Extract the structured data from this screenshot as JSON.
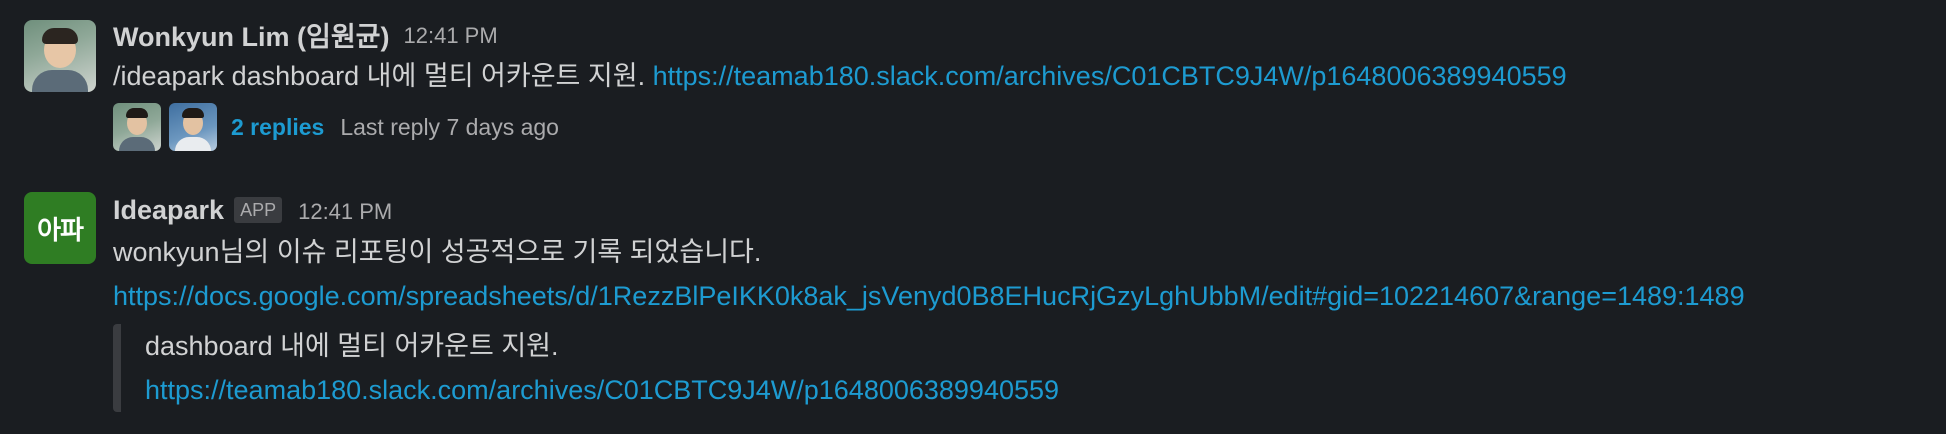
{
  "messages": [
    {
      "sender": "Wonkyun Lim (임원균)",
      "time": "12:41 PM",
      "avatar_icon": "user-photo",
      "text": "/ideapark dashboard 내에 멀티 어카운트 지원.",
      "link": "https://teamab180.slack.com/archives/C01CBTC9J4W/p1648006389940559",
      "thread": {
        "replies_label": "2 replies",
        "last_reply": "Last reply 7 days ago"
      }
    },
    {
      "sender": "Ideapark",
      "badge": "APP",
      "time": "12:41 PM",
      "avatar_text": "아파",
      "avatar_color": "#2f7d23",
      "text": "wonkyun님의 이슈 리포팅이 성공적으로 기록 되었습니다.",
      "link": "https://docs.google.com/spreadsheets/d/1RezzBlPeIKK0k8ak_jsVenyd0B8EHucRjGzyLghUbbM/edit#gid=102214607&range=1489:1489",
      "attachment": {
        "text": "dashboard 내에 멀티 어카운트 지원.",
        "link": "https://teamab180.slack.com/archives/C01CBTC9J4W/p1648006389940559"
      }
    }
  ],
  "colors": {
    "background": "#1a1d21",
    "text": "#d1d2d3",
    "muted": "#ababad",
    "link": "#1d9bd1"
  }
}
